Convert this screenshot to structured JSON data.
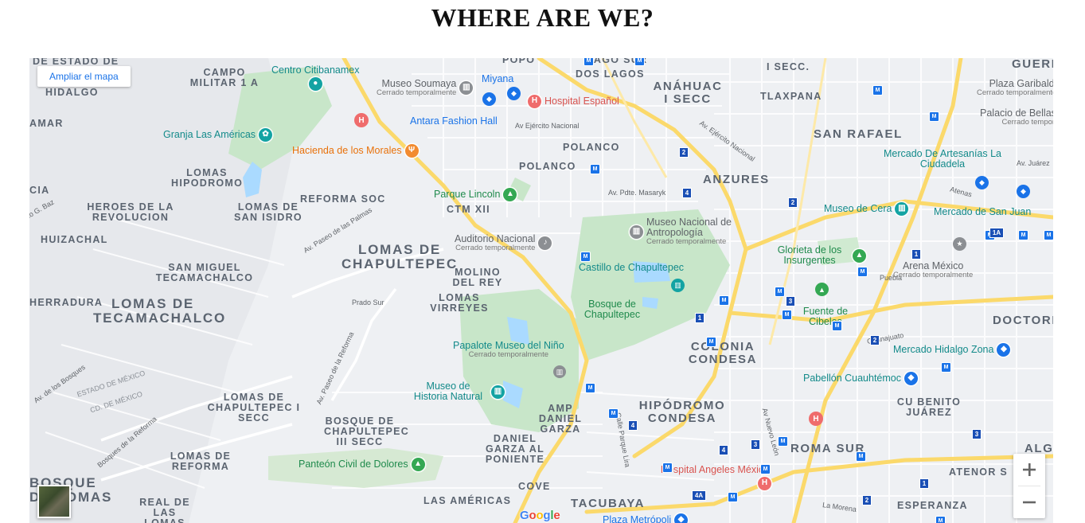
{
  "page": {
    "title": "WHERE ARE WE?"
  },
  "map": {
    "enlarge_label": "Ampliar el mapa",
    "zoom_in": "+",
    "zoom_out": "−",
    "logo_letters": [
      "G",
      "o",
      "o",
      "g",
      "l",
      "e"
    ],
    "logo_colors": [
      "#4285F4",
      "#EA4335",
      "#FBBC05",
      "#4285F4",
      "#34A853",
      "#EA4335"
    ],
    "colors": {
      "land": "#eef0f3",
      "park": "#c8e6c9",
      "water": "#aadaff",
      "highway": "#fbd96b",
      "road": "#ffffff",
      "metro": "#1a73e8"
    },
    "areas": [
      "DE ESTADO DE",
      "CAMPO MILITAR 1 A",
      "HIDALGO",
      "AMAR",
      "LOMAS HIPODROMO",
      "REFORMA SOC",
      "HEROES DE LA REVOLUCION",
      "LOMAS DE SAN ISIDRO",
      "HUIZACHAL",
      "SAN MIGUEL TECAMACHALCO",
      "HERRADURA",
      "LOMAS DE TECAMACHALCO",
      "CIA",
      "LOMAS DE CHAPULTEPEC",
      "MOLINO DEL REY",
      "LOMAS VIRREYES",
      "LOMAS DE CHAPULTEPEC I SECC",
      "BOSQUE DE CHAPULTEPEC III SECC",
      "DANIEL GARZA AL PONIENTE",
      "AMP DANIEL GARZA",
      "LOMAS DE REFORMA",
      "BOSQUE DE LOMAS",
      "REAL DE LAS LOMAS",
      "LAS AMÉRICAS",
      "COVE",
      "TACUBAYA",
      "POLANCO",
      "POLANCO",
      "CTM XII",
      "ANÁHUAC I SECC",
      "DOS LAGOS",
      "LAGO SUR",
      "POPO",
      "TLAXPANA",
      "I SECC.",
      "SAN RAFAEL",
      "ANZURES",
      "COLONIA CONDESA",
      "HIPÓDROMO CONDESA",
      "ROMA SUR",
      "ESPERANZA",
      "ATENOR S",
      "CU BENITO JUÁREZ",
      "DOCTORE",
      "GUERR",
      "ALGA"
    ],
    "streets": [
      "Av Ejército Nacional",
      "Av. Ejército Nacional",
      "Av. Pdte. Masaryk",
      "Av. Paseo de las Palmas",
      "Prado Sur",
      "Av. Paseo de la Reforma",
      "Av. de los Bosques",
      "ESTADO DE MÉXICO",
      "CD. DE MÉXICO",
      "Bosques de la Reforma",
      "Calle Parque Lira",
      "Av Nuevo León",
      "Guanajuato",
      "Puebla",
      "Atenas",
      "Av. Juárez",
      "La Morena",
      "lo G. Baz"
    ],
    "pois": [
      {
        "name": "Centro Citibanamex",
        "sub": "",
        "icon": "pin-icon"
      },
      {
        "name": "Museo Soumaya",
        "sub": "Cerrado temporalmente",
        "icon": "museum-icon"
      },
      {
        "name": "Miyana",
        "sub": "",
        "icon": "shopping-icon"
      },
      {
        "name": "Hospital Español",
        "sub": "",
        "icon": "hospital-icon"
      },
      {
        "name": "Antara Fashion Hall",
        "sub": "",
        "icon": "shopping-icon"
      },
      {
        "name": "Granja Las Américas",
        "sub": "",
        "icon": "park-icon"
      },
      {
        "name": "Hacienda de los Morales",
        "sub": "",
        "icon": "restaurant-icon"
      },
      {
        "name": "Parque Lincoln",
        "sub": "",
        "icon": "tree-icon"
      },
      {
        "name": "Museo Nacional de Antropología",
        "sub": "Cerrado temporalmente",
        "icon": "museum-icon"
      },
      {
        "name": "Auditorio Nacional",
        "sub": "Cerrado temporalmente",
        "icon": "music-icon"
      },
      {
        "name": "Castillo de Chapultepec",
        "sub": "",
        "icon": "museum-icon"
      },
      {
        "name": "Bosque de Chapultepec",
        "sub": "",
        "icon": ""
      },
      {
        "name": "Papalote Museo del Niño",
        "sub": "Cerrado temporalmente",
        "icon": "museum-icon"
      },
      {
        "name": "Museo de Historia Natural",
        "sub": "",
        "icon": "museum-icon"
      },
      {
        "name": "Panteón Civil de Dolores",
        "sub": "",
        "icon": "tree-icon"
      },
      {
        "name": "Hospital Angeles México",
        "sub": "",
        "icon": "hospital-icon"
      },
      {
        "name": "Plaza Metrópoli",
        "sub": "",
        "icon": "shopping-icon"
      },
      {
        "name": "Plaza Garibaldi",
        "sub": "Cerrado temporalmente",
        "icon": ""
      },
      {
        "name": "Palacio de Bellas Artes",
        "sub": "Cerrado temporalmente",
        "icon": ""
      },
      {
        "name": "Mercado De Artesanías La Ciudadela",
        "sub": "",
        "icon": "shopping-icon"
      },
      {
        "name": "Museo de Cera",
        "sub": "",
        "icon": "museum-icon"
      },
      {
        "name": "Mercado de San Juan",
        "sub": "",
        "icon": "shopping-icon"
      },
      {
        "name": "Glorieta de los Insurgentes",
        "sub": "",
        "icon": "tree-icon"
      },
      {
        "name": "Arena México",
        "sub": "Cerrado temporalmente",
        "icon": "arena-icon"
      },
      {
        "name": "Fuente de Cibeles",
        "sub": "",
        "icon": "tree-icon"
      },
      {
        "name": "Mercado Hidalgo Zona",
        "sub": "",
        "icon": "shopping-icon"
      },
      {
        "name": "Pabellón Cuauhtémoc",
        "sub": "",
        "icon": "shopping-icon"
      }
    ],
    "metro_badges": [
      "1",
      "1A",
      "2",
      "3",
      "4",
      "4A"
    ]
  }
}
